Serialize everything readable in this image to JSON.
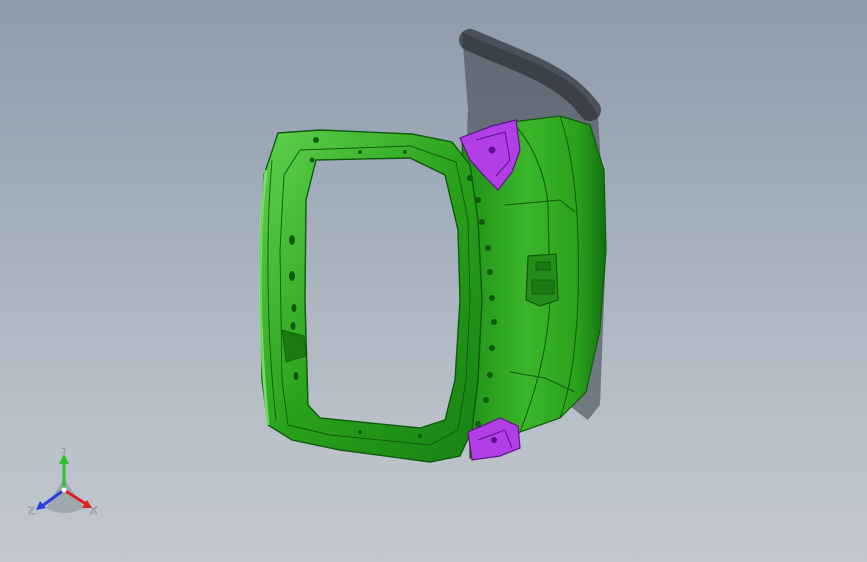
{
  "view": {
    "colors": {
      "part_primary": "#2aa21c",
      "part_dark": "#147010",
      "part_light": "#6ad85a",
      "part_secondary": "#b23fe6",
      "part_secondary_dark": "#6f1aa0",
      "shadow": "#3a3f46",
      "background_top": "#8e9bab",
      "background_bottom": "#c2c7cd"
    }
  },
  "triad": {
    "x_label": "X",
    "y_label": "Y",
    "z_label": "Z",
    "x_color": "#e02020",
    "y_color": "#2fbf2f",
    "z_color": "#2a3fe0"
  }
}
